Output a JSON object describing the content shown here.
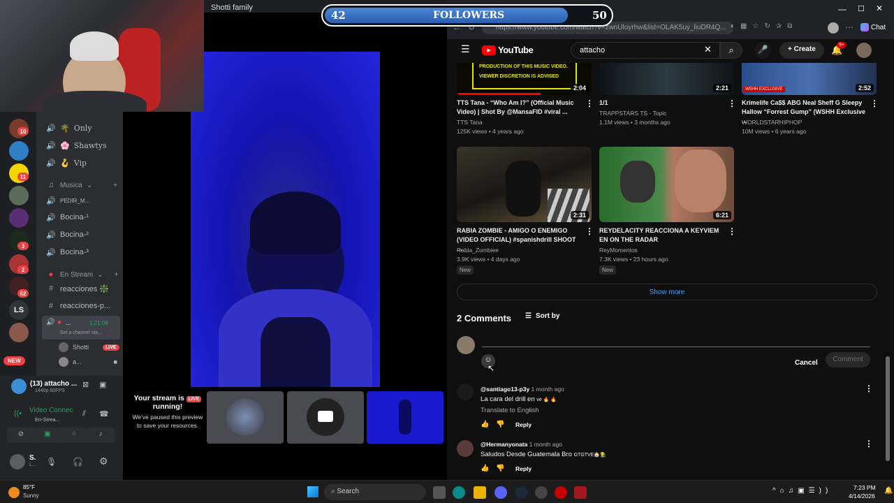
{
  "followers": {
    "current": "42",
    "label": "FOLLOWERS",
    "goal": "50",
    "progress": 0.84
  },
  "discord": {
    "stream_window_title": "Shotti family",
    "guild_badges": [
      "10",
      "11",
      "3",
      "2",
      "62"
    ],
    "guild_text": "LS",
    "new_badge": "NEW",
    "channels": [
      {
        "icon": "speaker-icon",
        "emoji": "🌴",
        "label": "Only"
      },
      {
        "icon": "speaker-icon",
        "emoji": "🌸",
        "label": "Shawtys"
      },
      {
        "icon": "speaker-icon",
        "emoji": "🪝",
        "label": "Vip"
      }
    ],
    "cat_musica": "Musica",
    "musica_channels": [
      "PEDIR_M...",
      "Bocina-¹",
      "Bocina-²",
      "Bocina-³"
    ],
    "cat_stream": "En Stream",
    "text_channels": [
      "reacciones ❇️",
      "reacciones-p..."
    ],
    "live_channel": {
      "label": "...",
      "time": "1:21:08",
      "status": "Set a channel sta..."
    },
    "members": [
      {
        "name": "Shotti",
        "badge": "LIVE"
      },
      {
        "name": "a..."
      }
    ],
    "activity": {
      "title": "(13) attacho ...",
      "sub": "1440p 60FPS"
    },
    "voice": {
      "title": "Video Connec",
      "sub": "En-Strea..."
    },
    "user": {
      "name": "S.",
      "status": "L..."
    },
    "paused": {
      "title": "Your stream is",
      "live": "LIVE",
      "title2": "running!",
      "body": "We've paused this preview to save your resources."
    }
  },
  "browser": {
    "url": "https://www.youtube.com/watch?v=zwnUluyrhw&list=OLAK5uy_liuDR4Q...",
    "chat_label": "Chat",
    "yt_logo": "YouTube",
    "search_query": "attacho",
    "create_label": "Create",
    "notif_count": "9+",
    "videos": [
      {
        "title": "TTS Tana - “Who Am I?” (Official Music Video) | Shot By @MansaFID  #viral ...",
        "channel": "TTS Tana",
        "meta": "125K views • 4 years ago",
        "duration": "2:04",
        "banner1": "PRODUCTION OF THIS MUSIC VIDEO.",
        "banner2": "VIEWER DISCRETION IS ADVISED"
      },
      {
        "title": "1/1",
        "channel": "TRAPPSTARS TS - Topic",
        "meta": "1.1M views • 3 months ago",
        "duration": "2:21"
      },
      {
        "title": "Krimelife Ca$$ ABG Neal Sheff G Sleepy Hallow “Forrest Gump” (WSHH Exclusive ...",
        "channel": "WORLDSTARHIPHOP",
        "meta": "10M views • 6 years ago",
        "duration": "2:52",
        "tag": "WSHH EXCLUSIVE"
      },
      {
        "title": "RABIA ZOMBIE - AMIGO O ENEMIGO (VIDEO OFFICIAL) #spanishdrill   SHOOT ...",
        "channel": "Rabia_Zombiee",
        "meta": "3.9K views • 4 days ago",
        "duration": "2:31",
        "badge": "New"
      },
      {
        "title": "REYDELACITY REACCIONA A KEYVIEM EN ON THE RADAR",
        "channel": "ReyMomentos",
        "meta": "7.3K views • 23 hours ago",
        "duration": "6:21",
        "badge": "New"
      }
    ],
    "show_more": "Show more",
    "comments_count": "2 Comments",
    "sort_by": "Sort by",
    "cancel": "Cancel",
    "comment_btn": "Comment",
    "comments": [
      {
        "author": "@santiago13-p3y",
        "time": "1 month ago",
        "text": "La cara del drill en",
        "tail": "ve 🔥 🔥",
        "translate": "Translate to English",
        "reply": "Reply"
      },
      {
        "author": "@Hermanyonata",
        "time": "1 month ago",
        "text": "Saludos Desde Guatemala Bro",
        "tail": "GTGTVE🏠🧑‍🌾",
        "reply": "Reply"
      }
    ]
  },
  "taskbar": {
    "temp": "85°F",
    "weather": "Sunny",
    "search": "Search",
    "time": "7:23 PM",
    "date": "4/14/2026"
  }
}
